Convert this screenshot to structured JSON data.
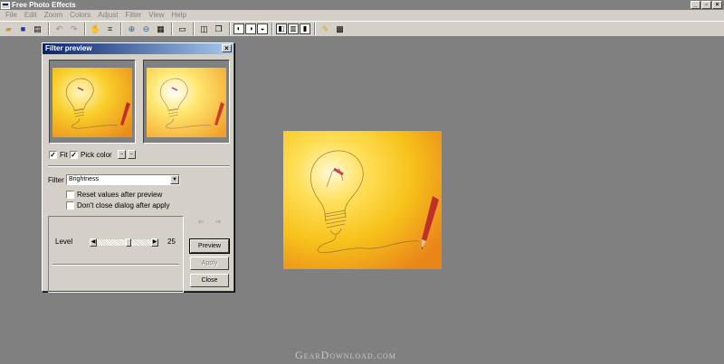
{
  "window": {
    "title": "Free Photo Effects"
  },
  "menu": [
    "File",
    "Edit",
    "Zoom",
    "Colors",
    "Adjust",
    "Filter",
    "View",
    "Help"
  ],
  "dialog": {
    "title": "Filter preview",
    "fit_label": "Fit",
    "fit_checked": true,
    "pick_color_label": "Pick color",
    "pick_color_checked": true,
    "filter_label": "Filter",
    "filter_value": "Brightness",
    "reset_label": "Reset values after preview",
    "reset_checked": false,
    "dont_close_label": "Don't close dialog after apply",
    "dont_close_checked": false,
    "level_label": "Level",
    "level_value": "25",
    "level_fraction": 0.6,
    "preview_button": "Preview",
    "apply_button": "Apply",
    "close_button": "Close"
  },
  "watermark": "GearDownload.com",
  "colors": {
    "background": "#808080",
    "face": "#d4d0c8",
    "title_active": "#0a246a",
    "image_yellow": "#f7c21a",
    "image_orange": "#e9861a"
  }
}
